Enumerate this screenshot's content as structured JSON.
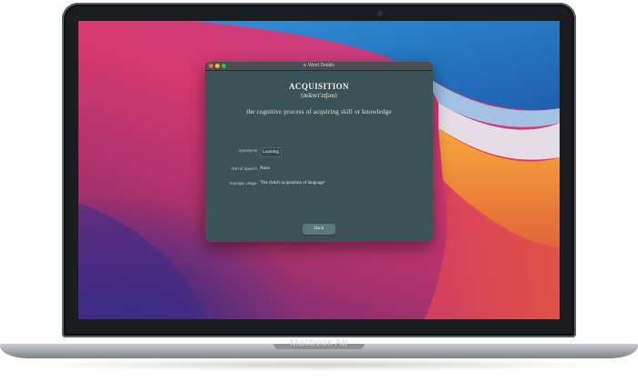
{
  "device": {
    "label": "Macbook Air"
  },
  "window": {
    "title": "Word Details"
  },
  "word": {
    "headword": "ACQUISITION",
    "phonetic": "(ækwɪˈzɪʃən)",
    "definition": "the cognitive process of acquiring skill or knowledge"
  },
  "details": [
    {
      "label": "Synonyms:",
      "value": "Learning"
    },
    {
      "label": "Part of Speech:",
      "value": "Noun"
    },
    {
      "label": "Example Usage:",
      "value": "'The child's acquisition of language'"
    }
  ],
  "actions": {
    "back_label": "Back"
  },
  "colors": {
    "window_bg": "#3b5256",
    "button_bg": "#5d777c",
    "text": "#f1efe6"
  }
}
